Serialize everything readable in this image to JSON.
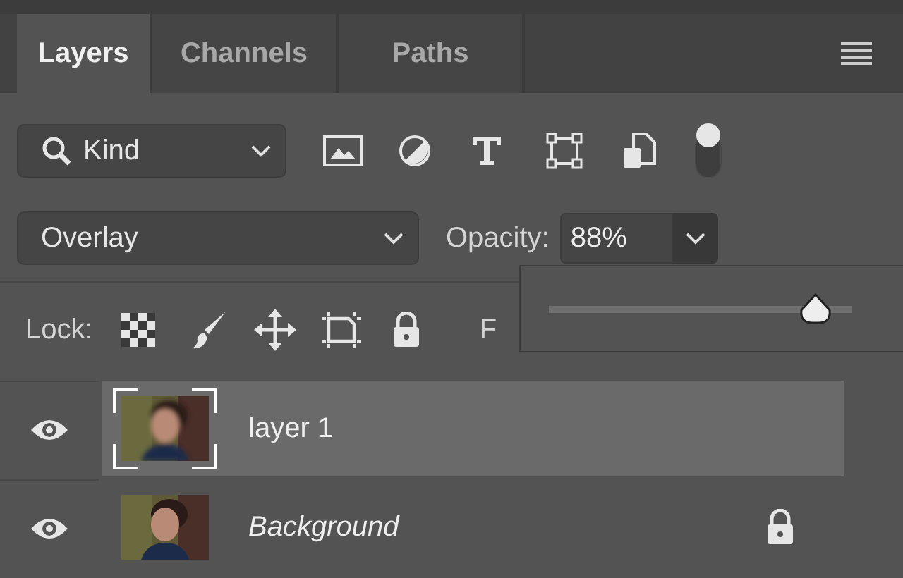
{
  "tabs": [
    {
      "label": "Layers",
      "selected": true
    },
    {
      "label": "Channels",
      "selected": false
    },
    {
      "label": "Paths",
      "selected": false
    }
  ],
  "filter": {
    "value": "Kind"
  },
  "blend_mode": {
    "value": "Overlay"
  },
  "opacity": {
    "label": "Opacity:",
    "value": "88%"
  },
  "opacity_slider": {
    "level": 0.88
  },
  "lock": {
    "label": "Lock:",
    "fill_label": "F"
  },
  "layers": [
    {
      "name": "layer 1",
      "kind": "layer",
      "selected": true,
      "visible": true,
      "locked": false,
      "blurred": true
    },
    {
      "name": "Background",
      "kind": "background",
      "selected": false,
      "visible": true,
      "locked": true,
      "blurred": false
    }
  ]
}
